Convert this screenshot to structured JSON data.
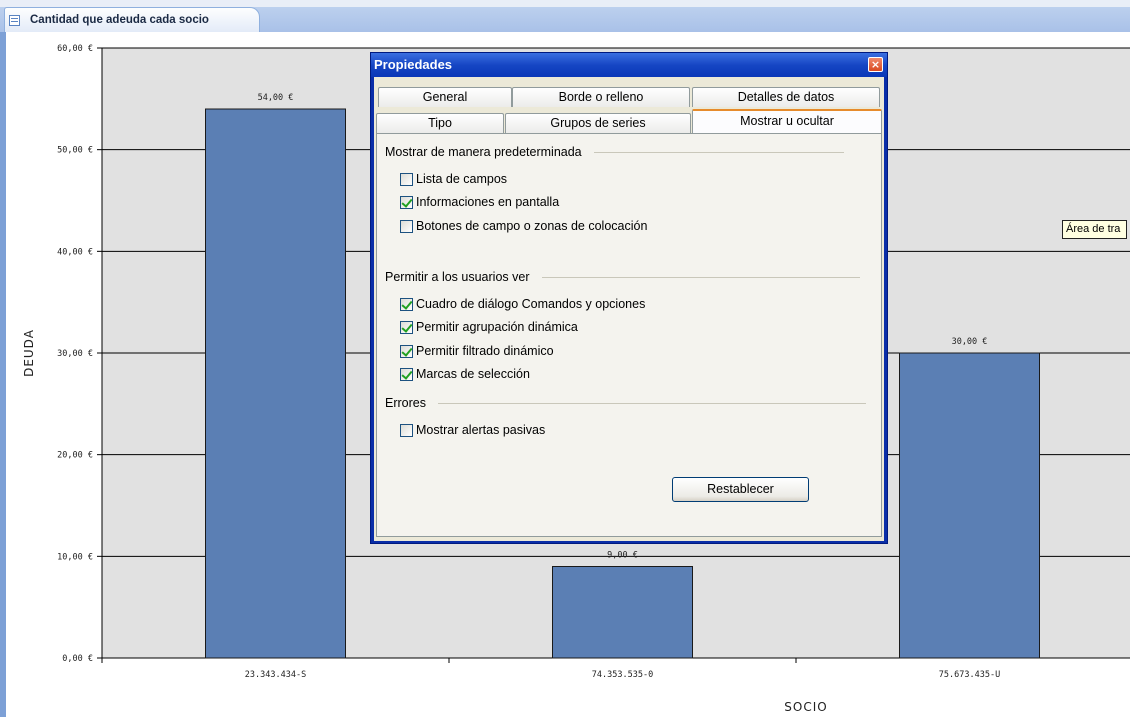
{
  "window": {
    "tab_title": "Cantidad que adeuda cada socio"
  },
  "chart_data": {
    "type": "bar",
    "categories": [
      "23.343.434-S",
      "74.353.535-0",
      "75.673.435-U"
    ],
    "values": [
      54,
      9,
      30
    ],
    "value_labels": [
      "54,00 €",
      "9,00 €",
      "30,00 €"
    ],
    "xlabel": "SOCIO",
    "ylabel": "DEUDA",
    "ylim": [
      0,
      60
    ],
    "yticks": [
      0,
      10,
      20,
      30,
      40,
      50,
      60
    ],
    "ytick_labels": [
      "0,00 €",
      "10,00 €",
      "20,00 €",
      "30,00 €",
      "40,00 €",
      "50,00 €",
      "60,00 €"
    ],
    "grid": true,
    "bar_color": "#5b7fb4",
    "plot_background": "#e1e1e1"
  },
  "tooltip": {
    "text": "Área de tra"
  },
  "dialog": {
    "title": "Propiedades",
    "close_label": "×",
    "tabs_row1": [
      "General",
      "Borde o relleno",
      "Detalles de datos"
    ],
    "tabs_row2": [
      "Tipo",
      "Grupos de series",
      "Mostrar u ocultar"
    ],
    "active_tab": "Mostrar u ocultar",
    "sections": {
      "default_display": {
        "header": "Mostrar de manera predeterminada",
        "items": [
          {
            "label": "Lista de campos",
            "checked": false
          },
          {
            "label": "Informaciones en pantalla",
            "checked": true
          },
          {
            "label": "Botones de campo o zonas de colocación",
            "checked": false
          }
        ]
      },
      "allow_users": {
        "header": "Permitir a los usuarios ver",
        "items": [
          {
            "label": "Cuadro de diálogo Comandos y opciones",
            "checked": true
          },
          {
            "label": "Permitir agrupación dinámica",
            "checked": true
          },
          {
            "label": "Permitir filtrado dinámico",
            "checked": true
          },
          {
            "label": "Marcas de selección",
            "checked": true
          }
        ]
      },
      "errors": {
        "header": "Errores",
        "items": [
          {
            "label": "Mostrar alertas pasivas",
            "checked": false
          }
        ]
      }
    },
    "reset_button": "Restablecer"
  }
}
